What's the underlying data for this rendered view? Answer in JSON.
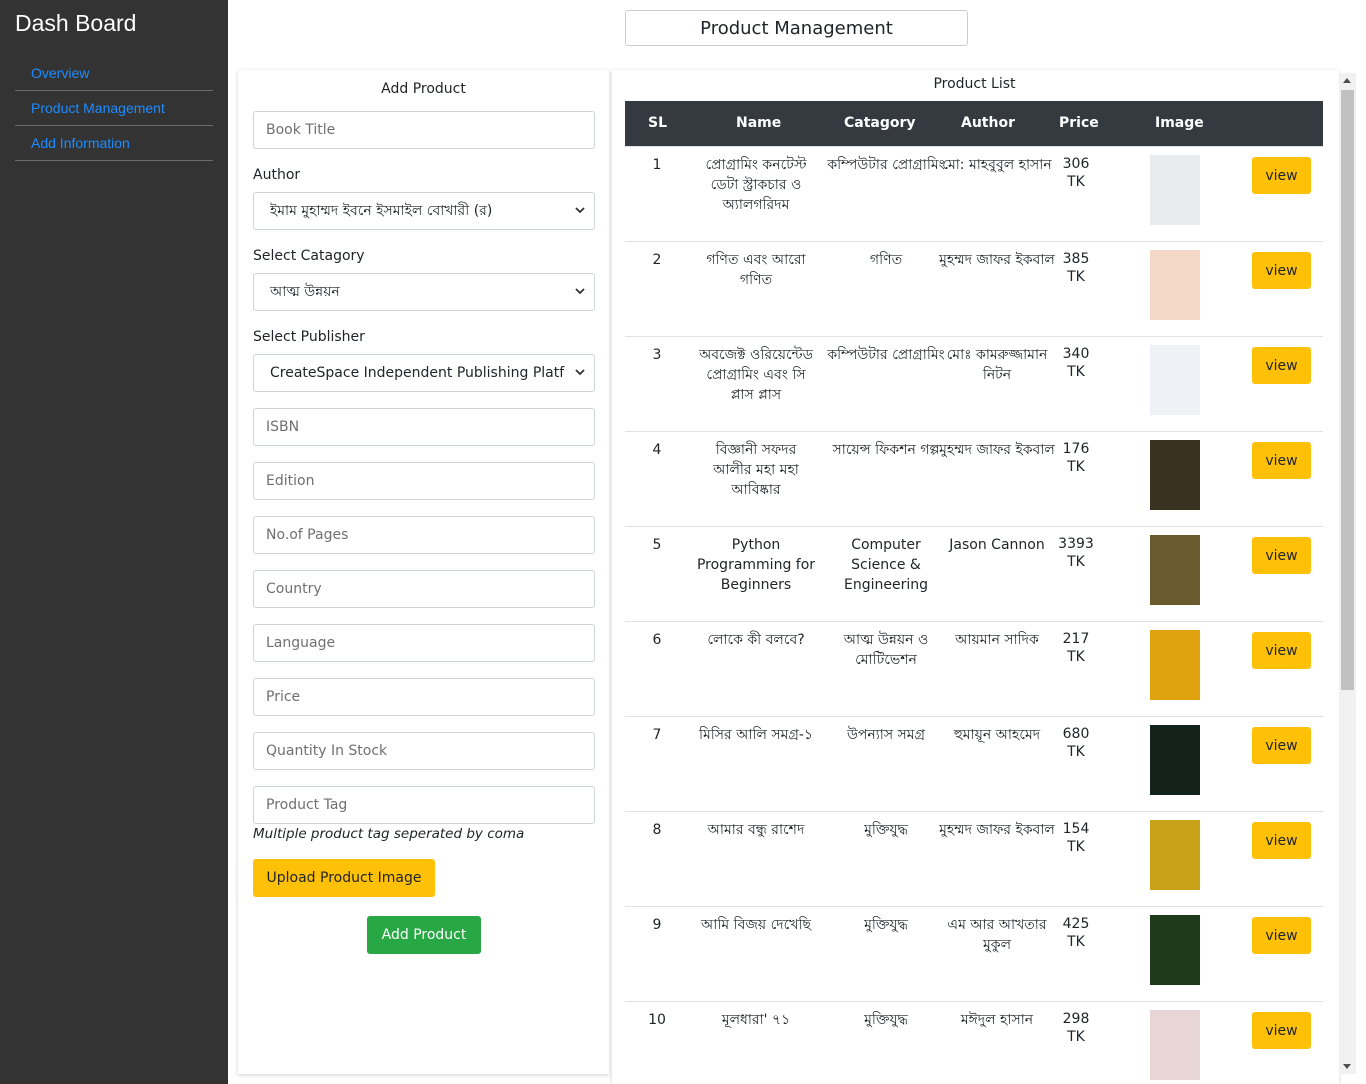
{
  "sidebar": {
    "brand": "Dash Board",
    "items": [
      {
        "label": "Overview"
      },
      {
        "label": "Product Management"
      },
      {
        "label": "Add Information"
      }
    ]
  },
  "page_title": "Product Management",
  "form": {
    "title": "Add Product",
    "book_title_placeholder": "Book Title",
    "author_label": "Author",
    "author_value": "ইমাম মুহাম্মদ ইবনে ইসমাইল বোখারী (র)",
    "category_label": "Select Catagory",
    "category_value": "আত্ম উন্নয়ন",
    "publisher_label": "Select Publisher",
    "publisher_value": "CreateSpace Independent Publishing Platf",
    "isbn_placeholder": "ISBN",
    "edition_placeholder": "Edition",
    "pages_placeholder": "No.of Pages",
    "country_placeholder": "Country",
    "language_placeholder": "Language",
    "price_placeholder": "Price",
    "stock_placeholder": "Quantity In Stock",
    "tag_placeholder": "Product Tag",
    "tag_hint": "Multiple product tag seperated by coma",
    "upload_label": "Upload Product Image",
    "add_label": "Add Product"
  },
  "list": {
    "title": "Product List",
    "headers": {
      "sl": "SL",
      "name": "Name",
      "category": "Catagory",
      "author": "Author",
      "price": "Price",
      "image": "Image"
    },
    "view_label": "view",
    "rows": [
      {
        "sl": "1",
        "name": "প্রোগ্রামিং কনটেস্ট ডেটা স্ট্রাকচার ও অ্যালগরিদম",
        "category": "কম্পিউটার প্রোগ্রামিং",
        "author": "মো: মাহবুবুল হাসান",
        "price": "306",
        "currency": "TK",
        "cover": "#e8ecef"
      },
      {
        "sl": "2",
        "name": "গণিত এবং আরো গণিত",
        "category": "গণিত",
        "author": "মুহম্মদ জাফর ইকবাল",
        "price": "385",
        "currency": "TK",
        "cover": "#f4d9c8"
      },
      {
        "sl": "3",
        "name": "অবজেক্ট ওরিয়েন্টেড প্রোগ্রামিং এবং সি প্লাস প্লাস",
        "category": "কম্পিউটার প্রোগ্রামিং",
        "author": "মোঃ কামরুজ্জামান নিটন",
        "price": "340",
        "currency": "TK",
        "cover": "#eef1f6"
      },
      {
        "sl": "4",
        "name": "বিজ্ঞানী সফদর আলীর মহা মহা আবিষ্কার",
        "category": "সায়েন্স ফিকশন গল্প",
        "author": "মুহম্মদ জাফর ইকবাল",
        "price": "176",
        "currency": "TK",
        "cover": "#3a3220"
      },
      {
        "sl": "5",
        "name": "Python Programming for Beginners",
        "category": "Computer Science & Engineering",
        "author": "Jason Cannon",
        "price": "3393",
        "currency": "TK",
        "cover": "#6b5a2e"
      },
      {
        "sl": "6",
        "name": "লোকে কী বলবে?",
        "category": "আত্ম উন্নয়ন ও মোটিভেশন",
        "author": "আয়মান সাদিক",
        "price": "217",
        "currency": "TK",
        "cover": "#e0a20f"
      },
      {
        "sl": "7",
        "name": "মিসির আলি সমগ্র-১",
        "category": "উপন্যাস সমগ্র",
        "author": "হুমায়ূন আহমেদ",
        "price": "680",
        "currency": "TK",
        "cover": "#13231c"
      },
      {
        "sl": "8",
        "name": "আমার বন্ধু রাশেদ",
        "category": "মুক্তিযুদ্ধ",
        "author": "মুহম্মদ জাফর ইকবাল",
        "price": "154",
        "currency": "TK",
        "cover": "#c9a21a"
      },
      {
        "sl": "9",
        "name": "আমি বিজয় দেখেছি",
        "category": "মুক্তিযুদ্ধ",
        "author": "এম আর আখতার মুকুল",
        "price": "425",
        "currency": "TK",
        "cover": "#1d3a1a"
      },
      {
        "sl": "10",
        "name": "মূলধারা' ৭১",
        "category": "মুক্তিযুদ্ধ",
        "author": "মঈদুল হাসান",
        "price": "298",
        "currency": "TK",
        "cover": "#e8d6d6"
      }
    ]
  }
}
